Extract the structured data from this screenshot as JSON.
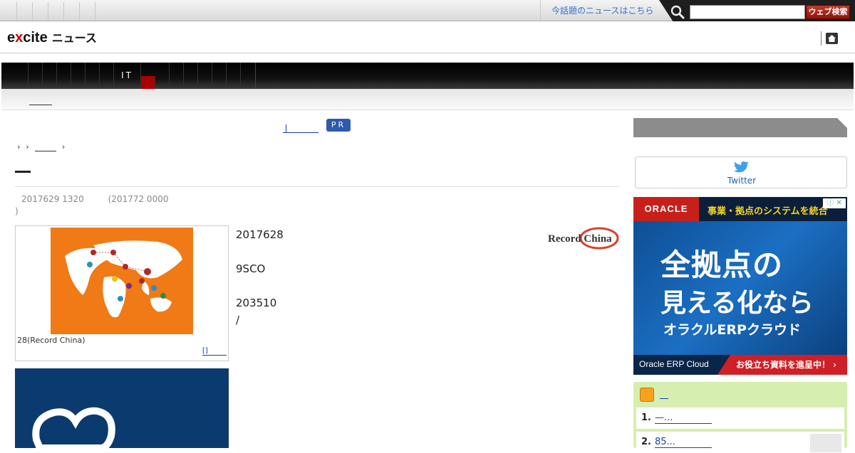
{
  "topbar": {
    "hot_news_link": "今話題のニュースはこちら",
    "search_placeholder": "",
    "search_button": "ウェブ検索"
  },
  "logo": {
    "brand_pre": "e",
    "brand_x": "x",
    "brand_post": "cite",
    "section": "ニュース"
  },
  "nav": {
    "tab_label": "IT"
  },
  "pr_badge": "PR",
  "article": {
    "dates": {
      "published": "2017629 1320",
      "updated": "(201772 0000",
      "paren_close": ")"
    },
    "photo_caption": "28(Record China)",
    "photo_more": "[]",
    "paragraphs": [
      "2017628",
      "9SCO",
      "203510",
      "/"
    ],
    "source_logo_text": "Record China"
  },
  "sidebar": {
    "twitter_label": "Twitter",
    "ad": {
      "brand": "ORACLE",
      "tagline": "事業・拠点のシステムを統合",
      "headline1": "全拠点の",
      "headline2": "見える化なら",
      "headline3": "オラクルERPクラウド",
      "product": "Oracle ERP Cloud",
      "cta": "お役立ち資料を進呈中！ ›",
      "adchoices": "ⓘ ✕"
    },
    "ranking": [
      {
        "rank": "1.",
        "title": "—..."
      },
      {
        "rank": "2.",
        "title": "85..."
      }
    ]
  },
  "colors": {
    "nav_active": "#aa0000",
    "accent_blue": "#2d59b0",
    "search_button": "#a8261b"
  }
}
